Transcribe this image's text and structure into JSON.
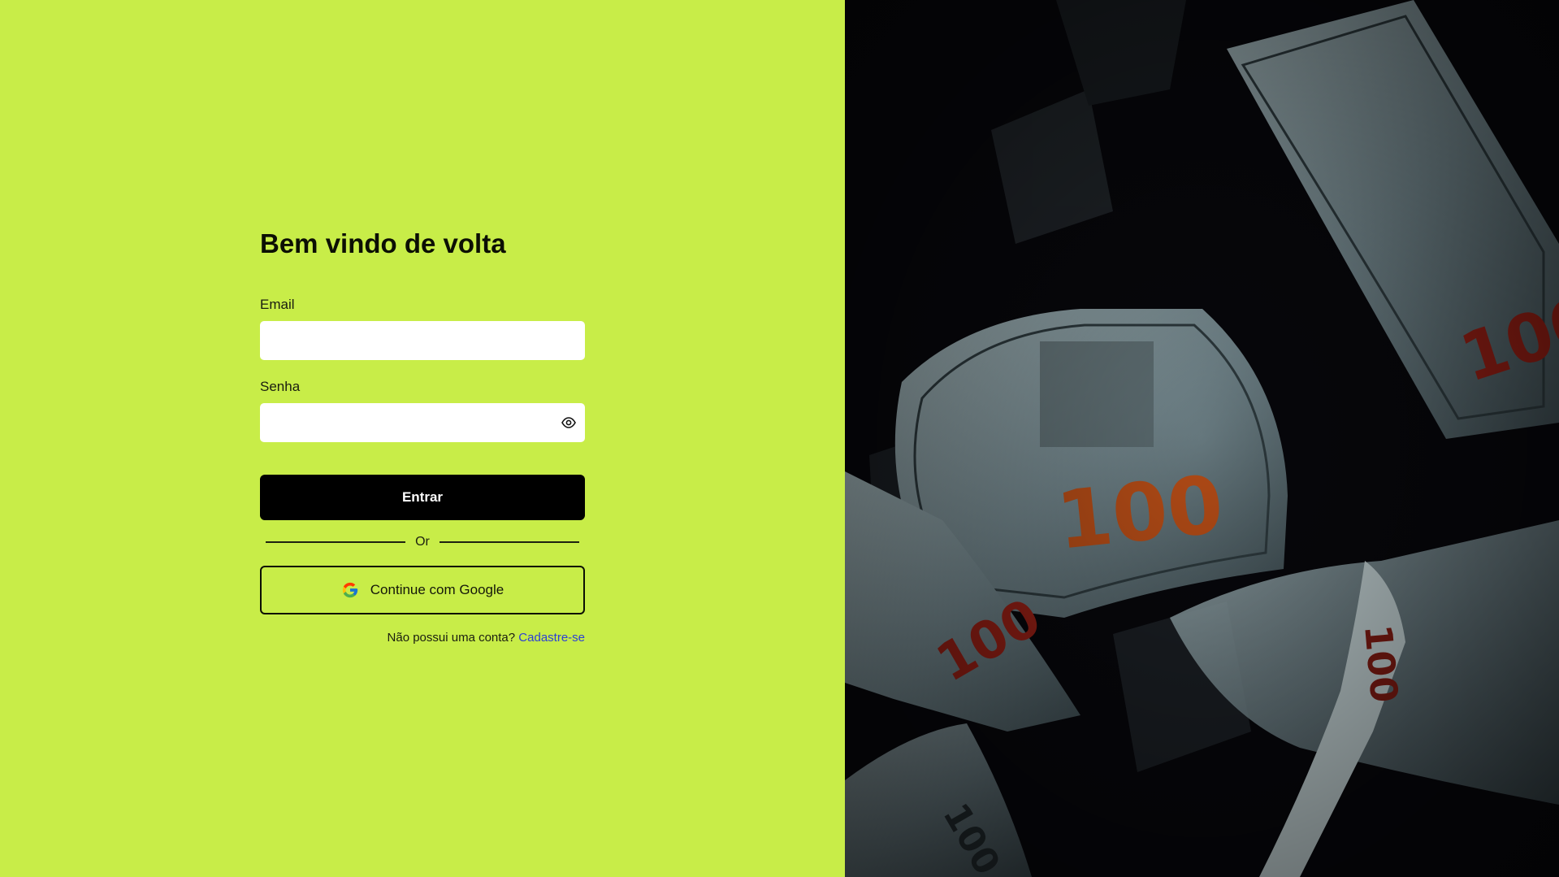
{
  "login": {
    "title": "Bem vindo de volta",
    "email_label": "Email",
    "email_value": "",
    "password_label": "Senha",
    "password_value": "",
    "submit_label": "Entrar",
    "divider_text": "Or",
    "google_label": "Continue com Google",
    "signup_prompt": "Não possui uma conta?",
    "signup_link": "Cadastre-se"
  },
  "hero": {
    "bill_denomination": "100",
    "image_subject": "falling-100-dollar-bills"
  },
  "colors": {
    "left_background": "#c8ed48",
    "right_background": "#07070b",
    "button_background": "#000000",
    "link": "#2c3fd6"
  },
  "icons": {
    "password_toggle": "eye-icon",
    "google": "google-g-icon"
  }
}
